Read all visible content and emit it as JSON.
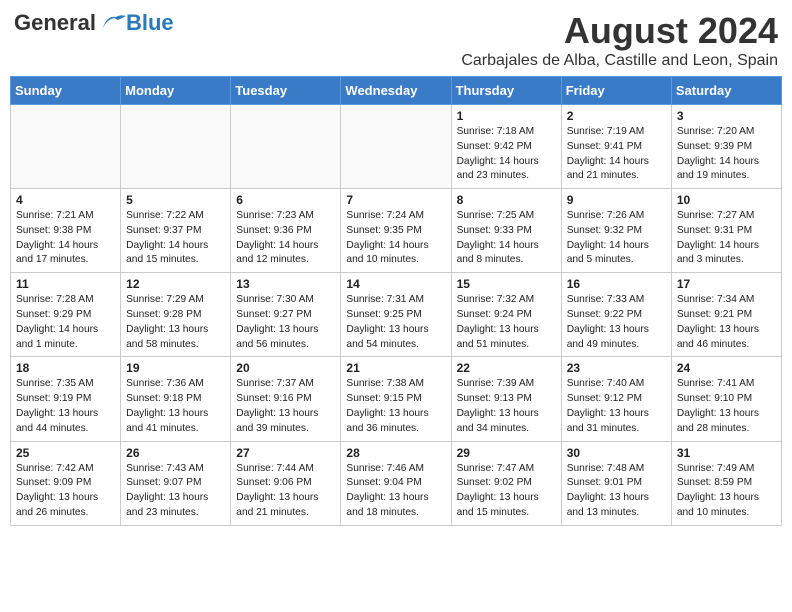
{
  "header": {
    "logo_general": "General",
    "logo_blue": "Blue",
    "month_year": "August 2024",
    "location": "Carbajales de Alba, Castille and Leon, Spain"
  },
  "days_of_week": [
    "Sunday",
    "Monday",
    "Tuesday",
    "Wednesday",
    "Thursday",
    "Friday",
    "Saturday"
  ],
  "weeks": [
    [
      {
        "day": "",
        "info": ""
      },
      {
        "day": "",
        "info": ""
      },
      {
        "day": "",
        "info": ""
      },
      {
        "day": "",
        "info": ""
      },
      {
        "day": "1",
        "info": "Sunrise: 7:18 AM\nSunset: 9:42 PM\nDaylight: 14 hours\nand 23 minutes."
      },
      {
        "day": "2",
        "info": "Sunrise: 7:19 AM\nSunset: 9:41 PM\nDaylight: 14 hours\nand 21 minutes."
      },
      {
        "day": "3",
        "info": "Sunrise: 7:20 AM\nSunset: 9:39 PM\nDaylight: 14 hours\nand 19 minutes."
      }
    ],
    [
      {
        "day": "4",
        "info": "Sunrise: 7:21 AM\nSunset: 9:38 PM\nDaylight: 14 hours\nand 17 minutes."
      },
      {
        "day": "5",
        "info": "Sunrise: 7:22 AM\nSunset: 9:37 PM\nDaylight: 14 hours\nand 15 minutes."
      },
      {
        "day": "6",
        "info": "Sunrise: 7:23 AM\nSunset: 9:36 PM\nDaylight: 14 hours\nand 12 minutes."
      },
      {
        "day": "7",
        "info": "Sunrise: 7:24 AM\nSunset: 9:35 PM\nDaylight: 14 hours\nand 10 minutes."
      },
      {
        "day": "8",
        "info": "Sunrise: 7:25 AM\nSunset: 9:33 PM\nDaylight: 14 hours\nand 8 minutes."
      },
      {
        "day": "9",
        "info": "Sunrise: 7:26 AM\nSunset: 9:32 PM\nDaylight: 14 hours\nand 5 minutes."
      },
      {
        "day": "10",
        "info": "Sunrise: 7:27 AM\nSunset: 9:31 PM\nDaylight: 14 hours\nand 3 minutes."
      }
    ],
    [
      {
        "day": "11",
        "info": "Sunrise: 7:28 AM\nSunset: 9:29 PM\nDaylight: 14 hours\nand 1 minute."
      },
      {
        "day": "12",
        "info": "Sunrise: 7:29 AM\nSunset: 9:28 PM\nDaylight: 13 hours\nand 58 minutes."
      },
      {
        "day": "13",
        "info": "Sunrise: 7:30 AM\nSunset: 9:27 PM\nDaylight: 13 hours\nand 56 minutes."
      },
      {
        "day": "14",
        "info": "Sunrise: 7:31 AM\nSunset: 9:25 PM\nDaylight: 13 hours\nand 54 minutes."
      },
      {
        "day": "15",
        "info": "Sunrise: 7:32 AM\nSunset: 9:24 PM\nDaylight: 13 hours\nand 51 minutes."
      },
      {
        "day": "16",
        "info": "Sunrise: 7:33 AM\nSunset: 9:22 PM\nDaylight: 13 hours\nand 49 minutes."
      },
      {
        "day": "17",
        "info": "Sunrise: 7:34 AM\nSunset: 9:21 PM\nDaylight: 13 hours\nand 46 minutes."
      }
    ],
    [
      {
        "day": "18",
        "info": "Sunrise: 7:35 AM\nSunset: 9:19 PM\nDaylight: 13 hours\nand 44 minutes."
      },
      {
        "day": "19",
        "info": "Sunrise: 7:36 AM\nSunset: 9:18 PM\nDaylight: 13 hours\nand 41 minutes."
      },
      {
        "day": "20",
        "info": "Sunrise: 7:37 AM\nSunset: 9:16 PM\nDaylight: 13 hours\nand 39 minutes."
      },
      {
        "day": "21",
        "info": "Sunrise: 7:38 AM\nSunset: 9:15 PM\nDaylight: 13 hours\nand 36 minutes."
      },
      {
        "day": "22",
        "info": "Sunrise: 7:39 AM\nSunset: 9:13 PM\nDaylight: 13 hours\nand 34 minutes."
      },
      {
        "day": "23",
        "info": "Sunrise: 7:40 AM\nSunset: 9:12 PM\nDaylight: 13 hours\nand 31 minutes."
      },
      {
        "day": "24",
        "info": "Sunrise: 7:41 AM\nSunset: 9:10 PM\nDaylight: 13 hours\nand 28 minutes."
      }
    ],
    [
      {
        "day": "25",
        "info": "Sunrise: 7:42 AM\nSunset: 9:09 PM\nDaylight: 13 hours\nand 26 minutes."
      },
      {
        "day": "26",
        "info": "Sunrise: 7:43 AM\nSunset: 9:07 PM\nDaylight: 13 hours\nand 23 minutes."
      },
      {
        "day": "27",
        "info": "Sunrise: 7:44 AM\nSunset: 9:06 PM\nDaylight: 13 hours\nand 21 minutes."
      },
      {
        "day": "28",
        "info": "Sunrise: 7:46 AM\nSunset: 9:04 PM\nDaylight: 13 hours\nand 18 minutes."
      },
      {
        "day": "29",
        "info": "Sunrise: 7:47 AM\nSunset: 9:02 PM\nDaylight: 13 hours\nand 15 minutes."
      },
      {
        "day": "30",
        "info": "Sunrise: 7:48 AM\nSunset: 9:01 PM\nDaylight: 13 hours\nand 13 minutes."
      },
      {
        "day": "31",
        "info": "Sunrise: 7:49 AM\nSunset: 8:59 PM\nDaylight: 13 hours\nand 10 minutes."
      }
    ]
  ]
}
